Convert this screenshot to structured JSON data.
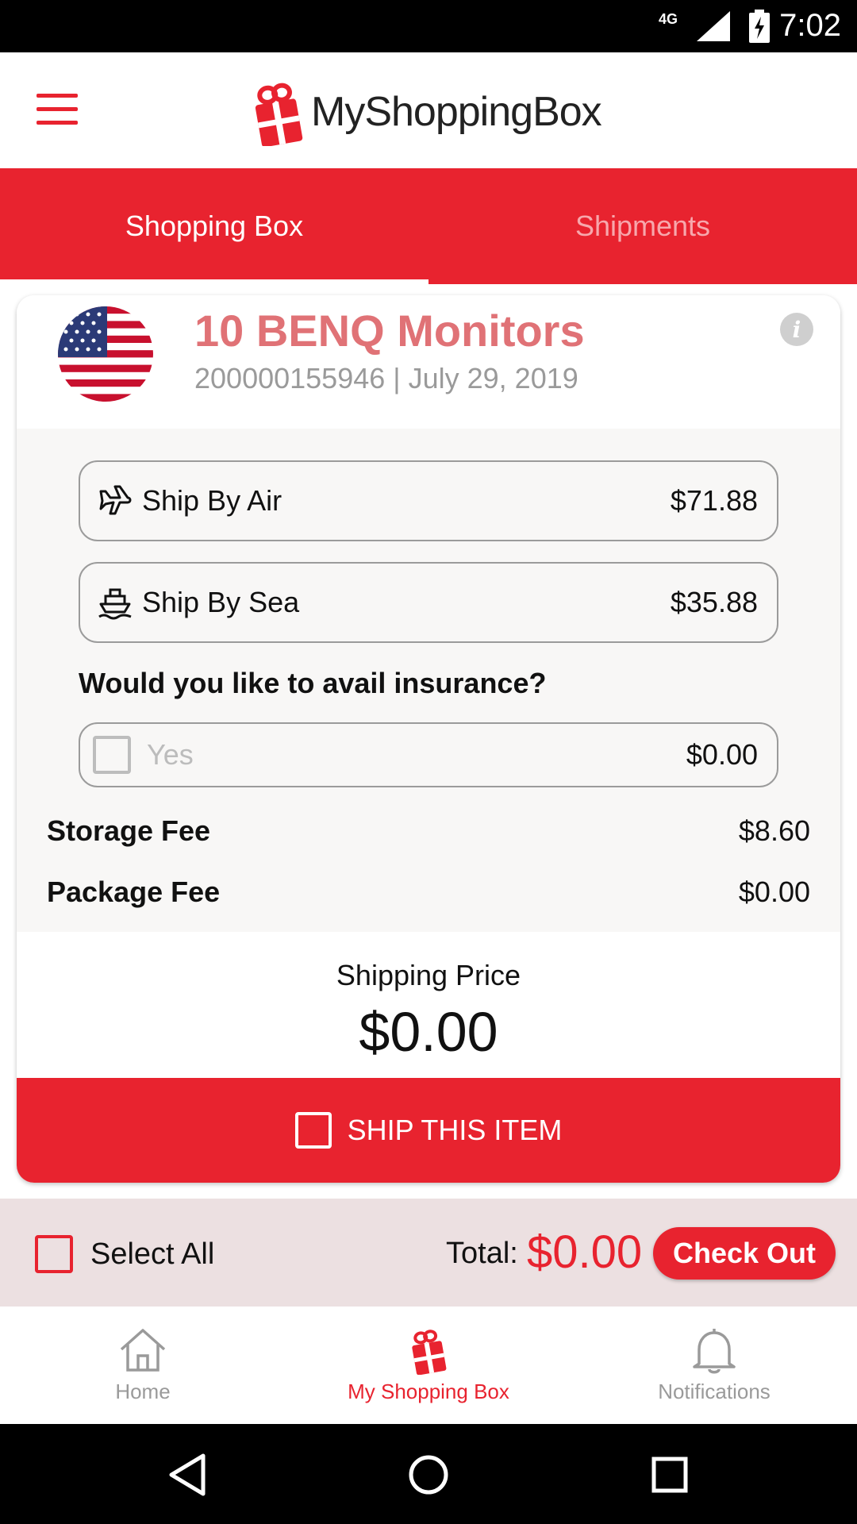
{
  "status_bar": {
    "network": "4G",
    "time": "7:02"
  },
  "app_bar": {
    "brand_name": "MyShoppingBox"
  },
  "tabs": [
    {
      "label": "Shopping Box",
      "active": true
    },
    {
      "label": "Shipments",
      "active": false
    }
  ],
  "item": {
    "title": "10 BENQ Monitors",
    "subtitle": "200000155946 | July 29, 2019",
    "origin_flag": "us-flag-icon"
  },
  "shipping_options": {
    "air": {
      "label": "Ship By Air",
      "price": "$71.88",
      "icon": "airplane-icon"
    },
    "sea": {
      "label": "Ship By Sea",
      "price": "$35.88",
      "icon": "ship-icon"
    }
  },
  "insurance": {
    "question": "Would you like to avail insurance?",
    "option_label": "Yes",
    "price": "$0.00",
    "checked": false
  },
  "fees": {
    "storage": {
      "label": "Storage Fee",
      "value": "$8.60"
    },
    "package": {
      "label": "Package Fee",
      "value": "$0.00"
    }
  },
  "shipping_price": {
    "label": "Shipping Price",
    "value": "$0.00"
  },
  "ship_button": {
    "label": "SHIP THIS ITEM",
    "checked": false
  },
  "summary": {
    "select_all_label": "Select All",
    "total_label": "Total:",
    "total_value": "$0.00",
    "checkout_label": "Check Out"
  },
  "bottom_nav": [
    {
      "label": "Home",
      "icon": "home-icon",
      "active": false
    },
    {
      "label": "My Shopping Box",
      "icon": "gift-icon",
      "active": true
    },
    {
      "label": "Notifications",
      "icon": "bell-icon",
      "active": false
    }
  ],
  "colors": {
    "brand_red": "#e8232f",
    "title_pink": "#e07276",
    "inactive_tab": "#f7a7ac",
    "summary_bg": "#ece0e1"
  }
}
